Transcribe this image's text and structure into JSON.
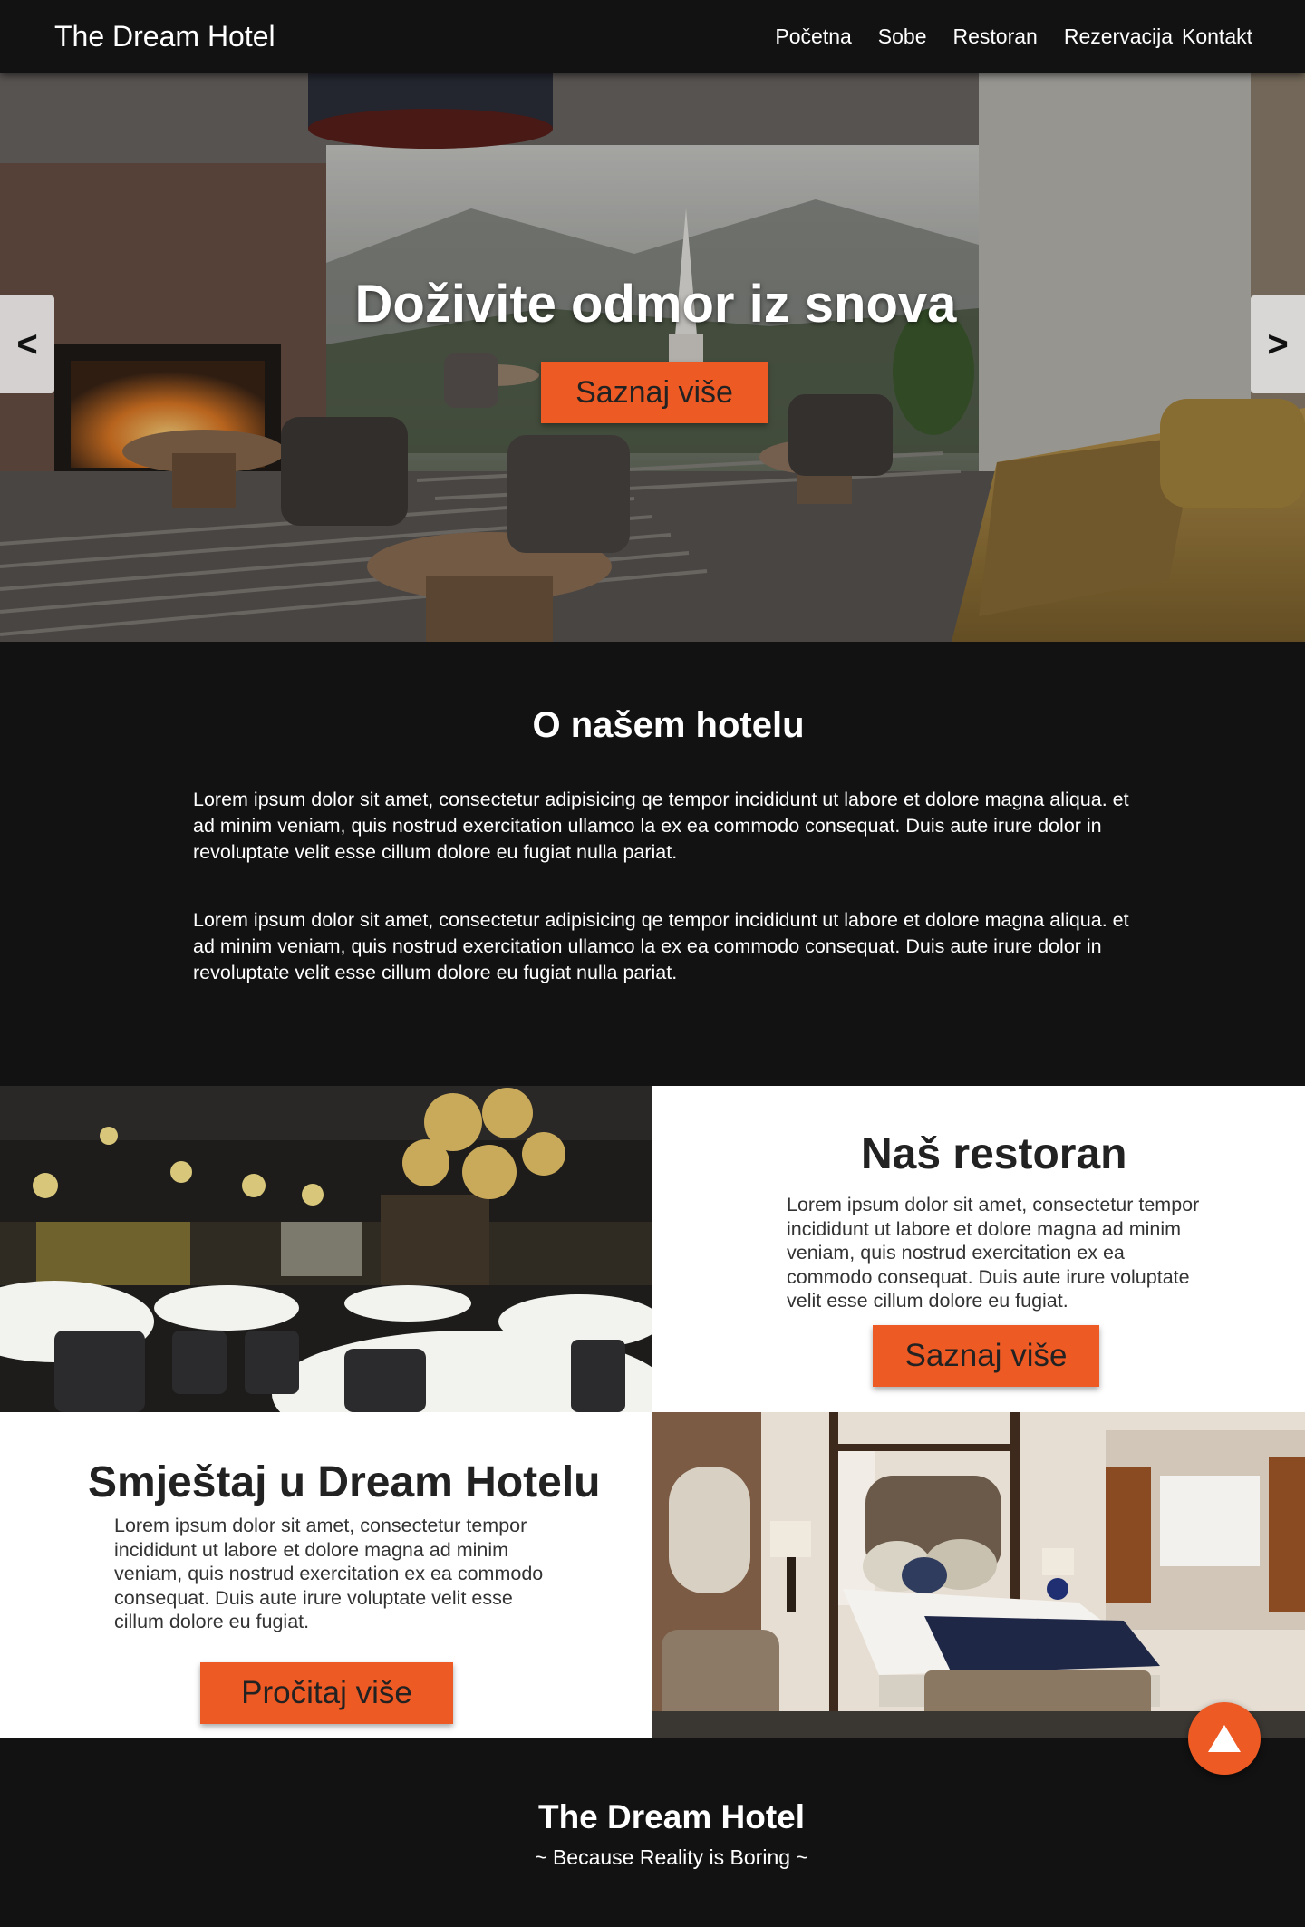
{
  "navbar": {
    "brand": "The Dream Hotel",
    "links": [
      "Početna",
      "Sobe",
      "Restoran",
      "Rezervacija",
      "Kontakt"
    ]
  },
  "hero": {
    "title": "Doživite odmor iz snova",
    "button_label": "Saznaj više",
    "prev_label": "<",
    "next_label": ">"
  },
  "about": {
    "title": "O našem hotelu",
    "paragraphs": [
      "Lorem ipsum dolor sit amet, consectetur adipisicing qe tempor incididunt ut labore et dolore magna aliqua. et ad minim veniam, quis nostrud exercitation ullamco la  ex ea commodo consequat. Duis aute irure dolor in revoluptate velit esse cillum dolore eu fugiat nulla pariat.",
      "Lorem ipsum dolor sit amet, consectetur adipisicing qe tempor incididunt ut labore et dolore magna aliqua. et ad minim veniam, quis nostrud exercitation ullamco la  ex ea commodo consequat. Duis aute irure dolor in revoluptate velit esse cillum dolore eu fugiat nulla pariat."
    ]
  },
  "restaurant": {
    "title": "Naš restoran",
    "text": "Lorem ipsum dolor sit amet, consectetur tempor incididunt ut labore et dolore magna ad minim veniam, quis nostrud exercitation ex ea commodo consequat. Duis aute irure voluptate velit esse cillum dolore eu fugiat.",
    "button_label": "Saznaj više"
  },
  "rooms": {
    "title": "Smještaj u Dream Hotelu",
    "text": "Lorem ipsum dolor sit amet, consectetur tempor incididunt ut labore et dolore magna ad minim veniam, quis nostrud exercitation ex ea commodo consequat. Duis aute irure voluptate velit esse cillum dolore eu fugiat.",
    "button_label": "Pročitaj više"
  },
  "footer": {
    "title": "The Dream Hotel",
    "tagline": "~ Because Reality is Boring ~"
  },
  "colors": {
    "accent": "#ee5a24",
    "dark": "#121212"
  }
}
